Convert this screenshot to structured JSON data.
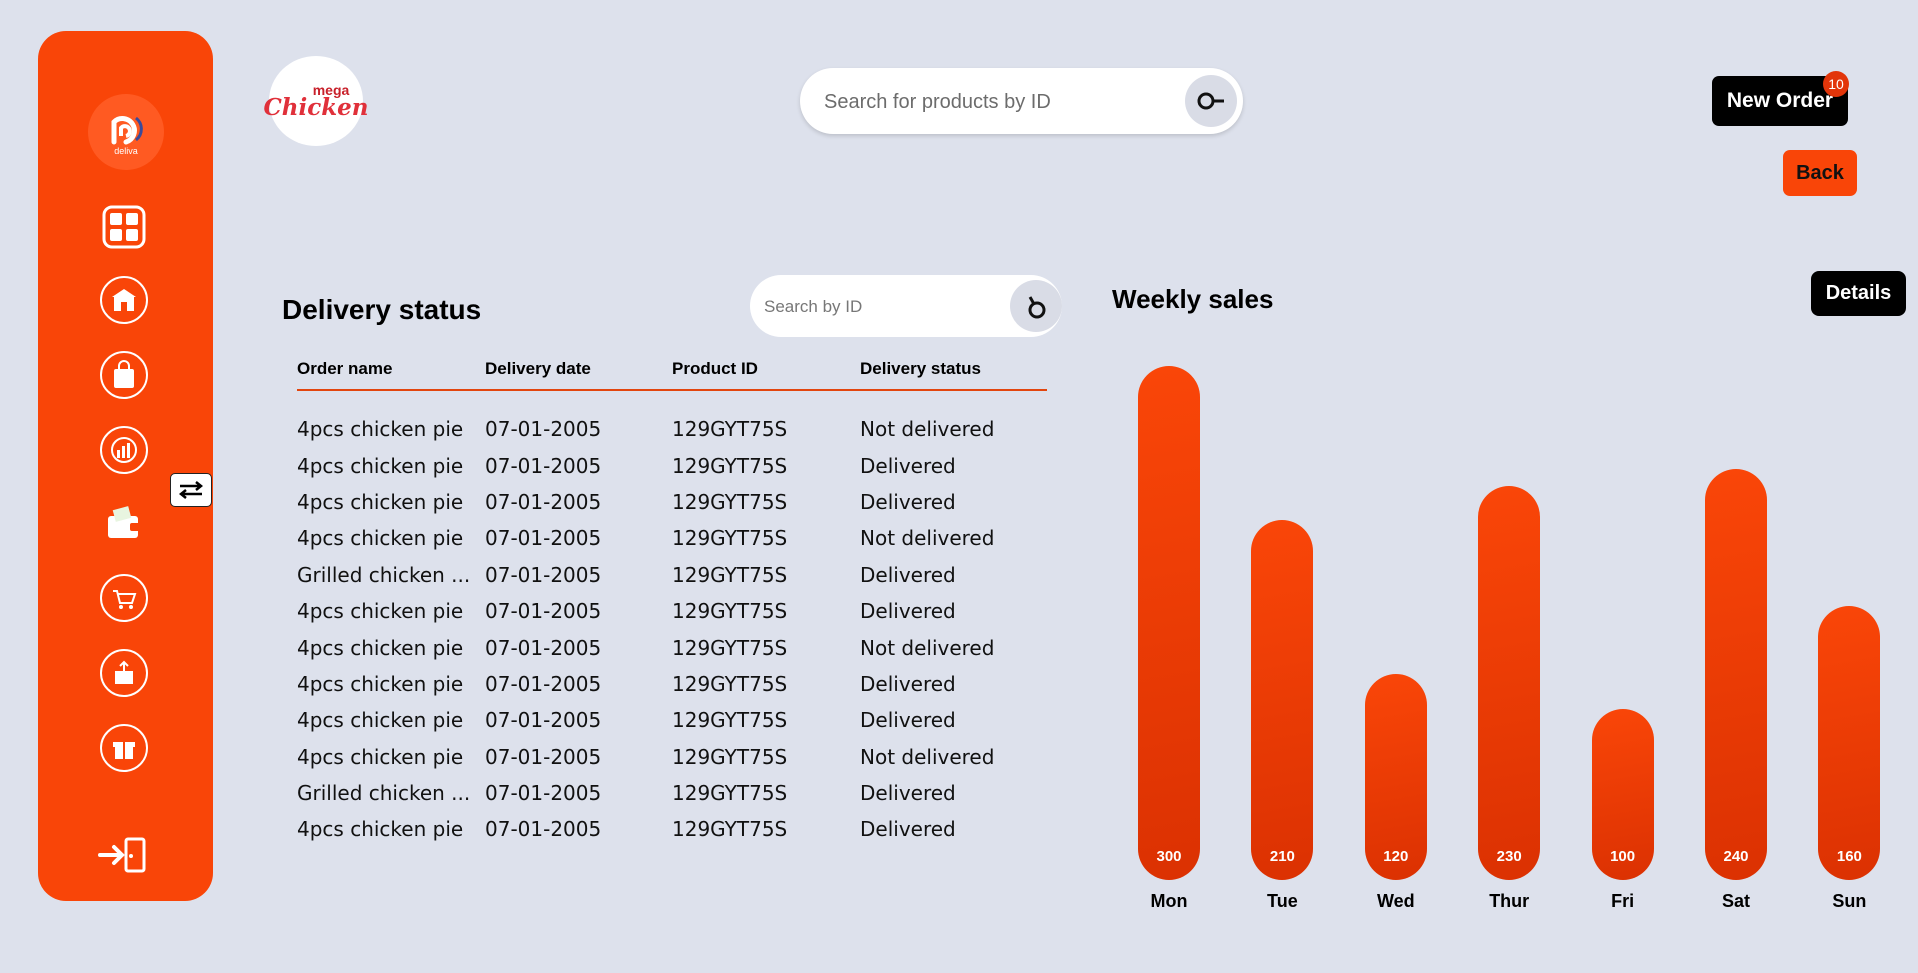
{
  "brand": {
    "name": "deliva"
  },
  "store_logo": {
    "line1": "mega",
    "line2": "Chicken"
  },
  "search": {
    "placeholder": "Search for products by ID"
  },
  "header": {
    "new_order_label": "New Order",
    "new_order_badge": "10",
    "back_label": "Back"
  },
  "delivery": {
    "title": "Delivery status",
    "search_placeholder": "Search by ID",
    "columns": [
      "Order name",
      "Delivery date",
      "Product ID",
      "Delivery status"
    ],
    "rows": [
      [
        "4pcs chicken pie",
        "07-01-2005",
        "129GYT75S",
        "Not delivered"
      ],
      [
        "4pcs chicken pie",
        "07-01-2005",
        "129GYT75S",
        "Delivered"
      ],
      [
        "4pcs chicken pie",
        "07-01-2005",
        "129GYT75S",
        "Delivered"
      ],
      [
        "4pcs chicken pie",
        "07-01-2005",
        "129GYT75S",
        "Not delivered"
      ],
      [
        "Grilled chicken ...",
        "07-01-2005",
        "129GYT75S",
        "Delivered"
      ],
      [
        "4pcs chicken pie",
        "07-01-2005",
        "129GYT75S",
        "Delivered"
      ],
      [
        "4pcs chicken pie",
        "07-01-2005",
        "129GYT75S",
        "Not delivered"
      ],
      [
        "4pcs chicken pie",
        "07-01-2005",
        "129GYT75S",
        "Delivered"
      ],
      [
        "4pcs chicken pie",
        "07-01-2005",
        "129GYT75S",
        "Delivered"
      ],
      [
        "4pcs chicken pie",
        "07-01-2005",
        "129GYT75S",
        "Not delivered"
      ],
      [
        "Grilled chicken ...",
        "07-01-2005",
        "129GYT75S",
        "Delivered"
      ],
      [
        "4pcs chicken pie",
        "07-01-2005",
        "129GYT75S",
        "Delivered"
      ]
    ]
  },
  "weekly": {
    "title": "Weekly sales",
    "details_label": "Details"
  },
  "chart_data": {
    "type": "bar",
    "title": "Weekly sales",
    "categories": [
      "Mon",
      "Tue",
      "Wed",
      "Thur",
      "Fri",
      "Sat",
      "Sun"
    ],
    "values": [
      300,
      210,
      120,
      230,
      100,
      240,
      160
    ],
    "value_labels": [
      "300",
      "210",
      "120",
      "230",
      "100",
      "240",
      "160"
    ],
    "grid": false,
    "bar_color": "#f94508"
  },
  "sidebar": {
    "icons": [
      "dashboard-icon",
      "restaurant-icon",
      "shopping-bag-icon",
      "analytics-icon",
      "wallet-icon",
      "cart-icon",
      "package-icon",
      "gift-icon"
    ],
    "toggle_icon": "swap-arrows-icon",
    "logout_icon": "logout-icon"
  },
  "colors": {
    "accent": "#f94508",
    "background": "#dde1ec",
    "dark": "#000000"
  }
}
